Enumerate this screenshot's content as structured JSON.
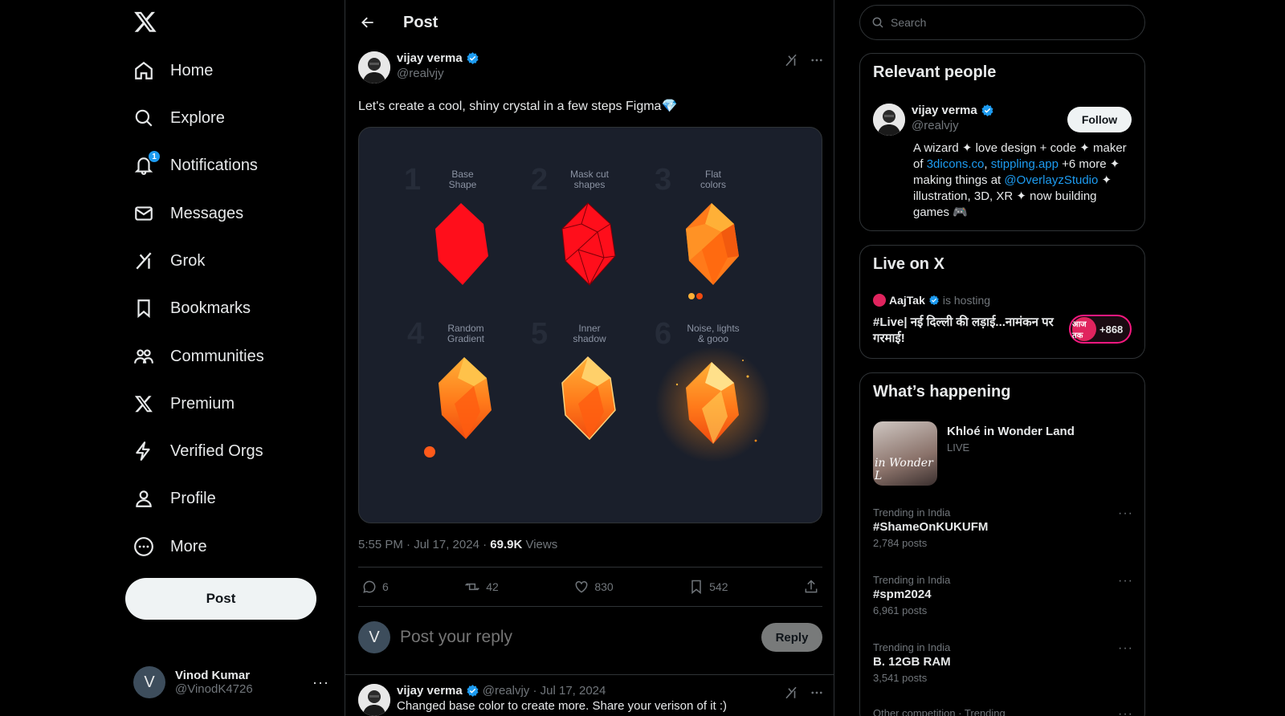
{
  "nav": {
    "items": [
      {
        "label": "Home",
        "icon": "home-icon"
      },
      {
        "label": "Explore",
        "icon": "search-icon"
      },
      {
        "label": "Notifications",
        "icon": "bell-icon",
        "badge": "1"
      },
      {
        "label": "Messages",
        "icon": "envelope-icon"
      },
      {
        "label": "Grok",
        "icon": "grok-icon"
      },
      {
        "label": "Bookmarks",
        "icon": "bookmark-icon"
      },
      {
        "label": "Communities",
        "icon": "people-icon"
      },
      {
        "label": "Premium",
        "icon": "x-logo-icon"
      },
      {
        "label": "Verified Orgs",
        "icon": "lightning-icon"
      },
      {
        "label": "Profile",
        "icon": "person-icon"
      },
      {
        "label": "More",
        "icon": "more-circle-icon"
      }
    ],
    "post_label": "Post"
  },
  "account": {
    "initial": "V",
    "name": "Vinod Kumar",
    "handle": "@VinodK4726",
    "more": "···"
  },
  "main": {
    "title": "Post",
    "tweet": {
      "author": "vijay verma",
      "handle": "@realvjy",
      "text": "Let's create a cool, shiny crystal in a few steps Figma💎",
      "image": {
        "steps": [
          {
            "num": "1",
            "label": "Base\nShape"
          },
          {
            "num": "2",
            "label": "Mask cut\nshapes"
          },
          {
            "num": "3",
            "label": "Flat\ncolors"
          },
          {
            "num": "4",
            "label": "Random\nGradient"
          },
          {
            "num": "5",
            "label": "Inner\nshadow"
          },
          {
            "num": "6",
            "label": "Noise, lights\n& gooo"
          }
        ]
      },
      "time": "5:55 PM · Jul 17, 2024 · ",
      "views_count": "69.9K",
      "views_label": " Views",
      "replies": "6",
      "reposts": "42",
      "likes": "830",
      "bookmarks": "542"
    },
    "reply": {
      "avatar": "V",
      "placeholder": "Post your reply",
      "button": "Reply"
    },
    "reply_tweet": {
      "author": "vijay verma",
      "meta": "@realvjy · Jul 17, 2024",
      "text": "Changed base color to create more. Share your verison of it :)"
    }
  },
  "right": {
    "search_placeholder": "Search",
    "relevant": {
      "title": "Relevant people",
      "name": "vijay verma",
      "handle": "@realvjy",
      "follow": "Follow",
      "bio_1": "A wizard ✦ love design + code ✦ maker of ",
      "link_1": "3dicons.co",
      "bio_2": ", ",
      "link_2": "stippling.app",
      "bio_3": " +6 more ✦ making things at ",
      "link_3": "@OverlayzStudio",
      "bio_4": " ✦ illustration, 3D, XR ✦ now building games 🎮"
    },
    "live": {
      "title": "Live on X",
      "host": "AajTak",
      "hosting": "is hosting",
      "headline": "#Live| नई दिल्ली की लड़ाई...नामंकन पर गरमाई!",
      "pill_logo": "आज तक",
      "count": "+868"
    },
    "happening": {
      "title": "What’s happening",
      "feature": {
        "name": "Khloé in Wonder Land",
        "status": "LIVE",
        "script": "in Wonder L"
      },
      "trends": [
        {
          "context": "Trending in India",
          "topic": "#ShameOnKUKUFM",
          "count": "2,784 posts"
        },
        {
          "context": "Trending in India",
          "topic": "#spm2024",
          "count": "6,961 posts"
        },
        {
          "context": "Trending in India",
          "topic": "B. 12GB RAM",
          "count": "3,541 posts"
        },
        {
          "context": "Other competition · Trending",
          "topic": "",
          "count": ""
        }
      ]
    }
  }
}
